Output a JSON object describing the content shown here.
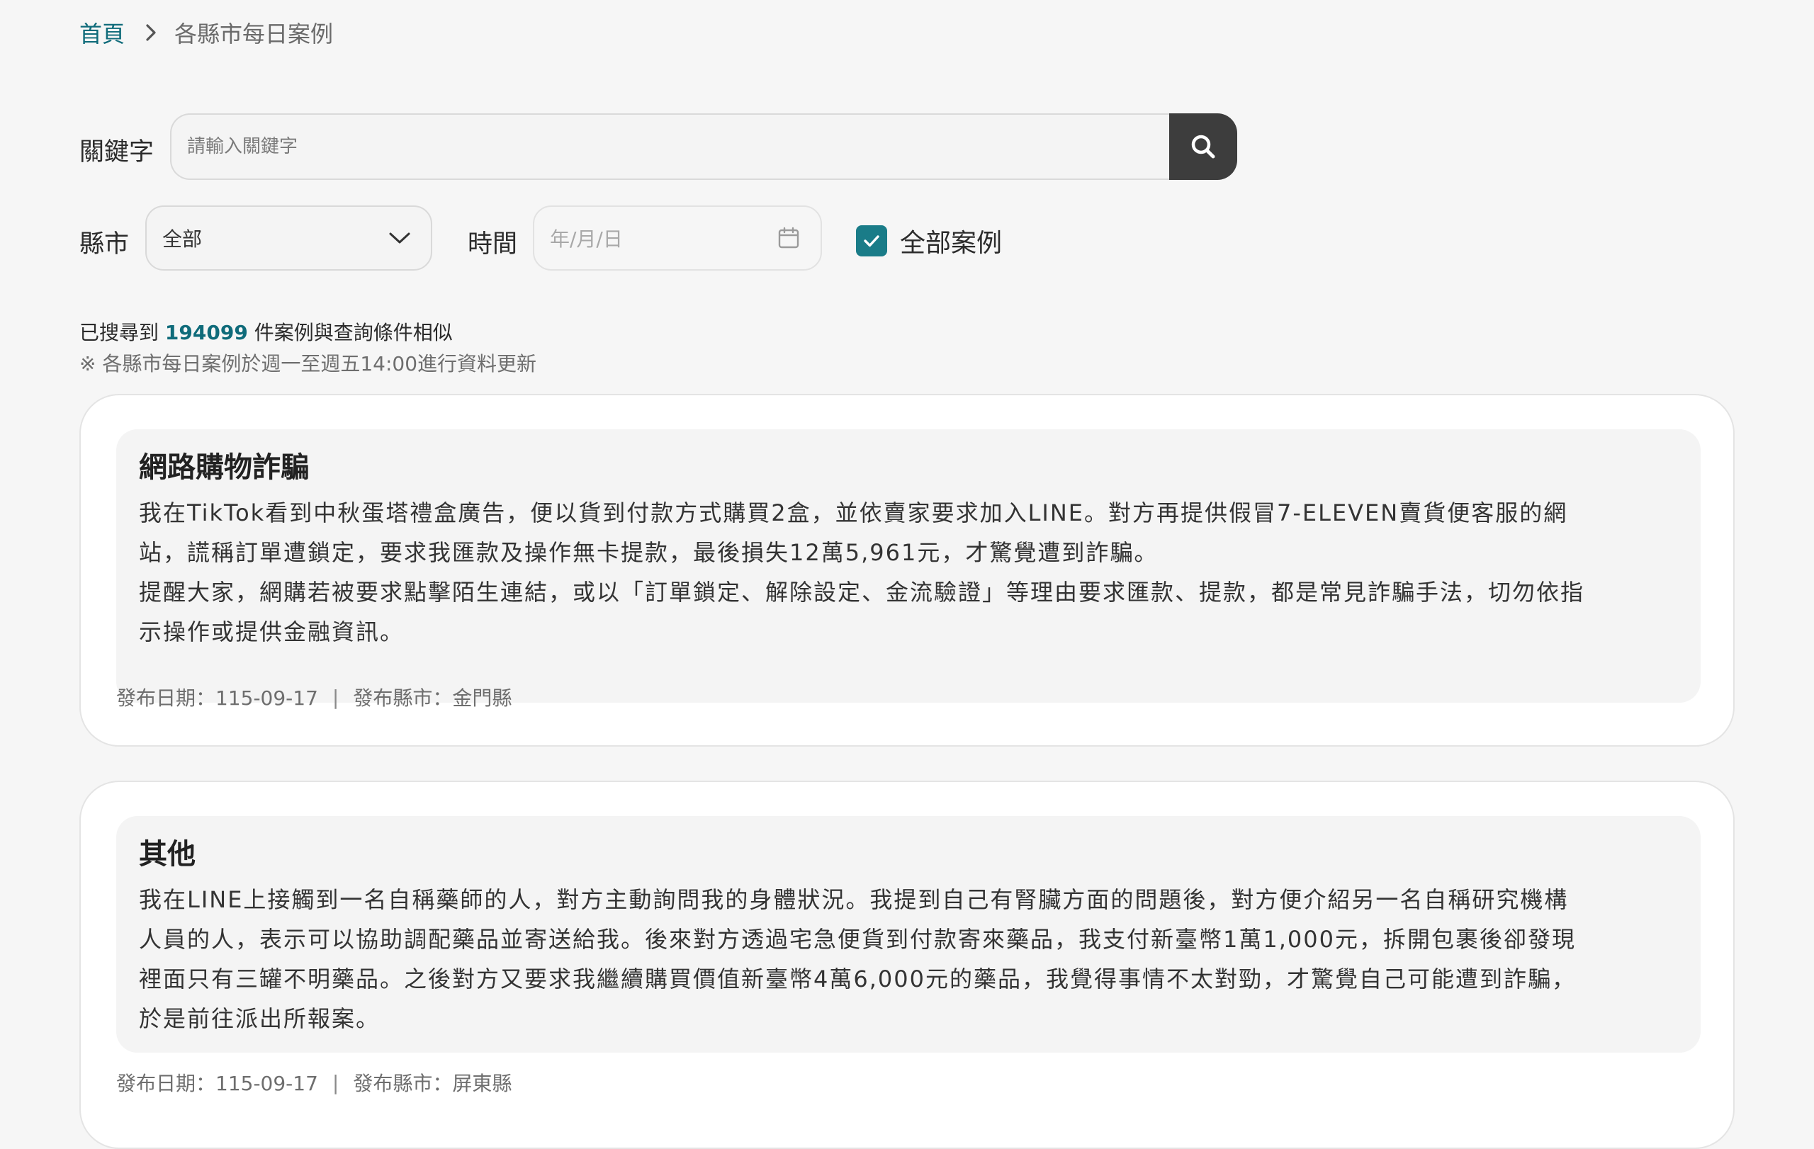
{
  "breadcrumb": {
    "home": "首頁",
    "current": "各縣市每日案例"
  },
  "search": {
    "label": "關鍵字",
    "placeholder": "請輸入關鍵字",
    "button_icon": "search-icon"
  },
  "filters": {
    "county_label": "縣市",
    "county_value": "全部",
    "time_label": "時間",
    "date_placeholder": "年/月/日",
    "all_cases_label": "全部案例",
    "all_cases_checked": true
  },
  "results": {
    "prefix": "已搜尋到 ",
    "count": "194099",
    "suffix": " 件案例與查詢條件相似",
    "note": "※ 各縣市每日案例於週一至週五14:00進行資料更新"
  },
  "cases": [
    {
      "title": "網路購物詐騙",
      "lines": [
        "我在TikTok看到中秋蛋塔禮盒廣告，便以貨到付款方式購買2盒，並依賣家要求加入LINE。對方再提供假冒7-ELEVEN賣貨便客服的網",
        "站，謊稱訂單遭鎖定，要求我匯款及操作無卡提款，最後損失12萬5,961元，才驚覺遭到詐騙。",
        "提醒大家，網購若被要求點擊陌生連結，或以「訂單鎖定、解除設定、金流驗證」等理由要求匯款、提款，都是常見詐騙手法，切勿依指",
        "示操作或提供金融資訊。"
      ],
      "date_label": "發布日期：115-09-17",
      "county_label": "發布縣市：金門縣"
    },
    {
      "title": "其他",
      "lines": [
        "我在LINE上接觸到一名自稱藥師的人，對方主動詢問我的身體狀況。我提到自己有腎臟方面的問題後，對方便介紹另一名自稱研究機構",
        "人員的人，表示可以協助調配藥品並寄送給我。後來對方透過宅急便貨到付款寄來藥品，我支付新臺幣1萬1,000元，拆開包裹後卻發現",
        "裡面只有三罐不明藥品。之後對方又要求我繼續購買價值新臺幣4萬6,000元的藥品，我覺得事情不太對勁，才驚覺自己可能遭到詐騙，",
        "於是前往派出所報案。"
      ],
      "date_label": "發布日期：115-09-17",
      "county_label": "發布縣市：屏東縣"
    }
  ],
  "meta_separator": "|",
  "colors": {
    "accent": "#0f6b7a",
    "checkbox": "#1a7c88",
    "search_button": "#3d3d3d",
    "page_bg": "#f6f6f6"
  }
}
